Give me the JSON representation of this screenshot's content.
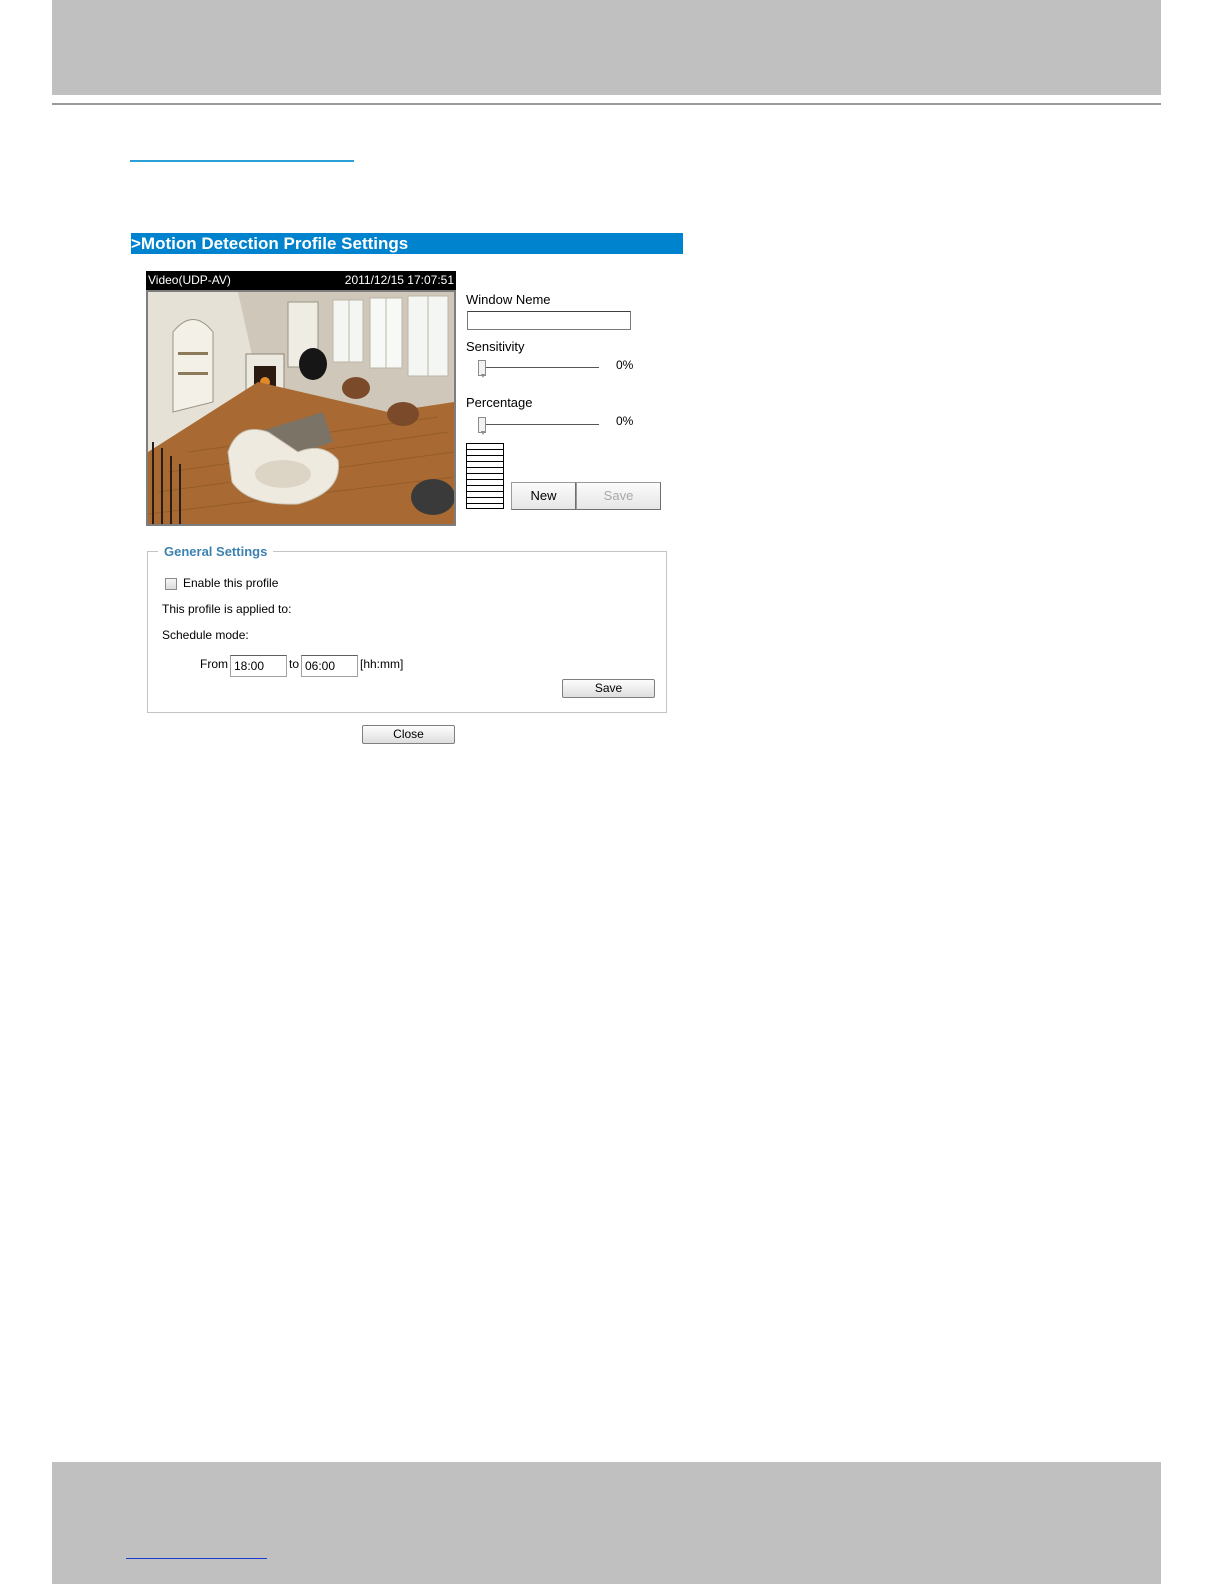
{
  "panel": {
    "title": ">Motion Detection Profile Settings"
  },
  "video": {
    "stream_label": "Video(UDP-AV)",
    "timestamp": "2011/12/15 17:07:51"
  },
  "window": {
    "name_label": "Window Neme",
    "name_value": "",
    "sensitivity_label": "Sensitivity",
    "sensitivity_value": "0%",
    "sensitivity_level": 0,
    "percentage_label": "Percentage",
    "percentage_value": "0%",
    "percentage_level": 0,
    "new_label": "New",
    "save_label": "Save"
  },
  "general": {
    "legend": "General Settings",
    "enable_label": "Enable this profile",
    "enable_checked": false,
    "applied_to_label": "This profile is applied to:",
    "schedule_label": "Schedule mode:",
    "from_label": "From",
    "from_value": "18:00",
    "to_label": "to",
    "to_value": "06:00",
    "unit_label": "[hh:mm]",
    "save_label": "Save"
  },
  "close_label": "Close",
  "colors": {
    "title_bar": "#0083cf",
    "legend_text": "#3c82b0",
    "header_band": "#c0c0c0"
  }
}
